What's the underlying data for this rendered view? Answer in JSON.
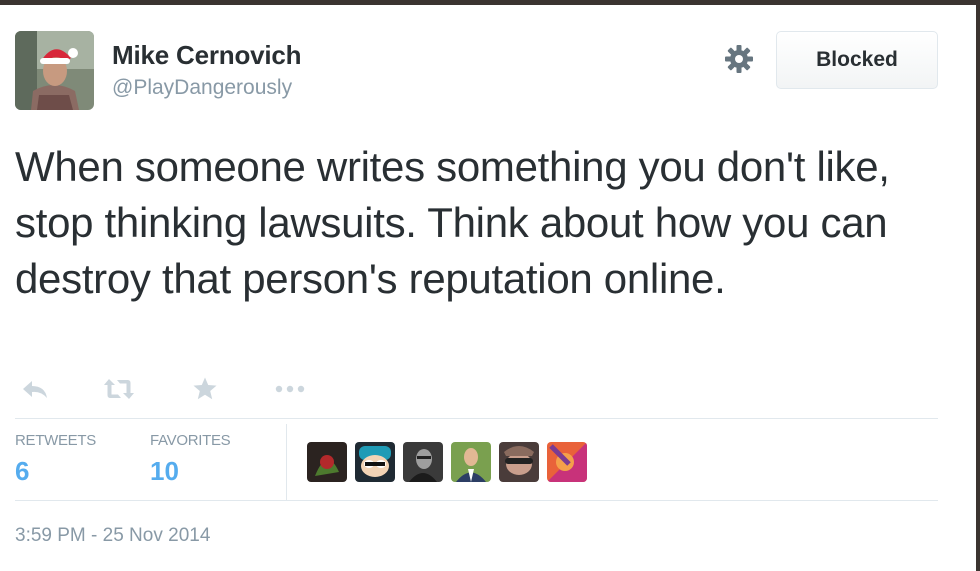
{
  "tweet": {
    "author_name": "Mike Cernovich",
    "author_handle": "@PlayDangerously",
    "follow_button_label": "Blocked",
    "text": "When someone writes something you don't like, stop thinking lawsuits. Think about how you can destroy that person's reputation online.",
    "timestamp": "3:59 PM - 25 Nov 2014"
  },
  "actions": [
    "reply-icon",
    "retweet-icon",
    "favorite-icon",
    "more-icon"
  ],
  "stats": {
    "retweets_label": "RETWEETS",
    "retweets_count": "6",
    "favorites_label": "FAVORITES",
    "favorites_count": "10"
  },
  "favoriter_avatars_count": 6,
  "colors": {
    "text": "#292f33",
    "muted": "#8899a6",
    "accent": "#55acee",
    "icon": "#ccd6dd",
    "divider": "#e1e8ed"
  }
}
